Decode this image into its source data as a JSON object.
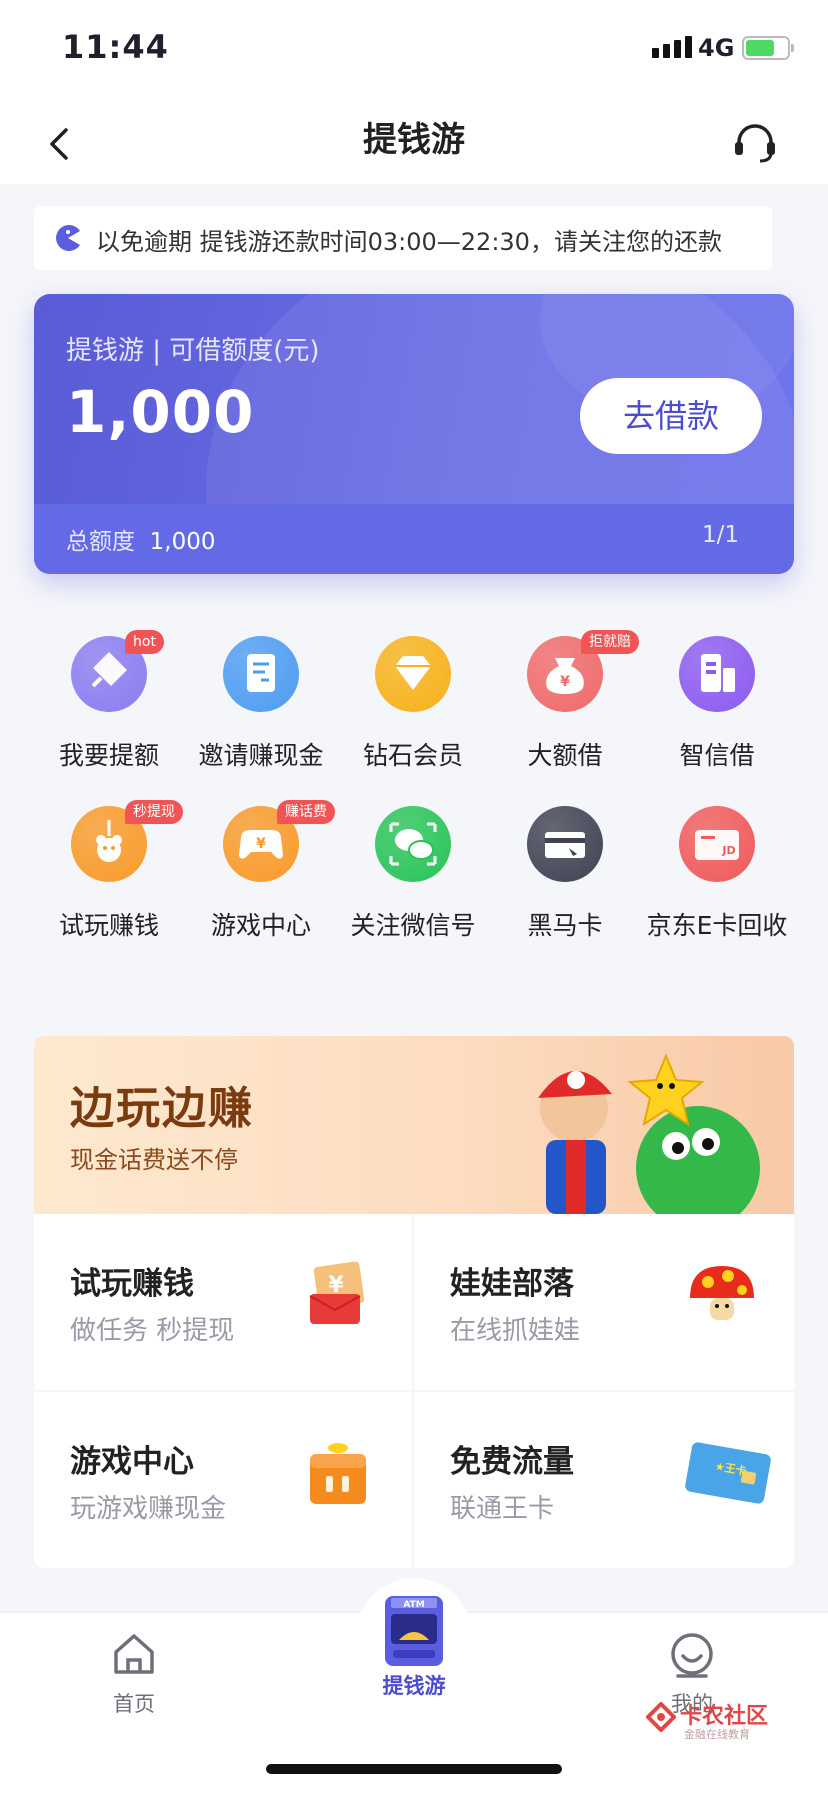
{
  "status_bar": {
    "time": "11:44",
    "network": "4G"
  },
  "nav": {
    "title": "提钱游"
  },
  "notice": {
    "text": "以免逾期     提钱游还款时间03:00—22:30，请关注您的还款"
  },
  "credit_card": {
    "label": "提钱游 | 可借额度(元)",
    "amount": "1,000",
    "button": "去借款",
    "total_label": "总额度",
    "total_value": "1,000",
    "page": "1/1"
  },
  "grid": [
    {
      "label": "我要提额",
      "badge": "hot",
      "icon": "rocket-icon",
      "color": "#8b7cf0"
    },
    {
      "label": "邀请赚现金",
      "badge": "",
      "icon": "invite-doc-icon",
      "color": "#4e9cf2"
    },
    {
      "label": "钻石会员",
      "badge": "",
      "icon": "diamond-icon",
      "color": "#f7b21a"
    },
    {
      "label": "大额借",
      "badge": "拒就赔",
      "icon": "money-bag-icon",
      "color": "#f06a6a"
    },
    {
      "label": "智信借",
      "badge": "",
      "icon": "building-icon",
      "color": "#8c5af0"
    },
    {
      "label": "试玩赚钱",
      "badge": "秒提现",
      "icon": "claw-icon",
      "color": "#f99a2a"
    },
    {
      "label": "游戏中心",
      "badge": "赚话费",
      "icon": "gamepad-icon",
      "color": "#f99a2a"
    },
    {
      "label": "关注微信号",
      "badge": "",
      "icon": "wechat-icon",
      "color": "#29c458"
    },
    {
      "label": "黑马卡",
      "badge": "",
      "icon": "card-icon",
      "color": "#3f4352"
    },
    {
      "label": "京东E卡回收",
      "badge": "",
      "icon": "jd-card-icon",
      "color": "#f05a5a"
    }
  ],
  "promo": {
    "title": "边玩边赚",
    "subtitle": "现金话费送不停"
  },
  "tiles": [
    {
      "title": "试玩赚钱",
      "subtitle": "做任务 秒提现",
      "icon": "red-envelope-icon"
    },
    {
      "title": "娃娃部落",
      "subtitle": "在线抓娃娃",
      "icon": "mushroom-icon"
    },
    {
      "title": "游戏中心",
      "subtitle": "玩游戏赚现金",
      "icon": "game-box-icon"
    },
    {
      "title": "免费流量",
      "subtitle": "联通王卡",
      "icon": "sim-card-icon"
    }
  ],
  "tabbar": {
    "items": [
      {
        "label": "首页",
        "icon": "home-icon"
      },
      {
        "label": "提钱游",
        "icon": "atm-icon"
      },
      {
        "label": "我的",
        "icon": "profile-icon"
      }
    ],
    "active_color": "#4b4ccf"
  },
  "watermark": {
    "title": "卡农社区",
    "subtitle": "金融在线教育"
  }
}
